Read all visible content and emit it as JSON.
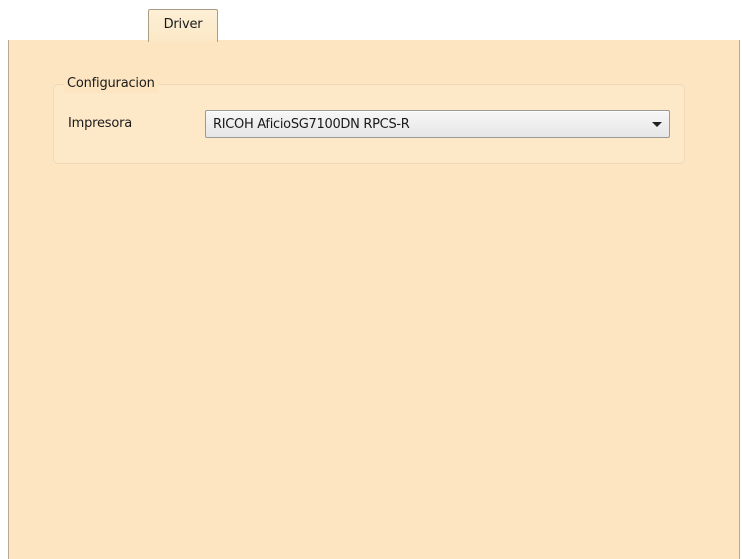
{
  "tabs": [
    {
      "label": "Driver",
      "active": true
    }
  ],
  "configuracion": {
    "group_title": "Configuracion",
    "printer_label": "Impresora",
    "printer_value": "RICOH AficioSG7100DN RPCS-R",
    "printer_dropdown_icon": "chevron-down-icon"
  },
  "colors": {
    "panel_background": "#fce5c0",
    "tab_background": "#fdf0d6",
    "border": "#b8ab96"
  }
}
